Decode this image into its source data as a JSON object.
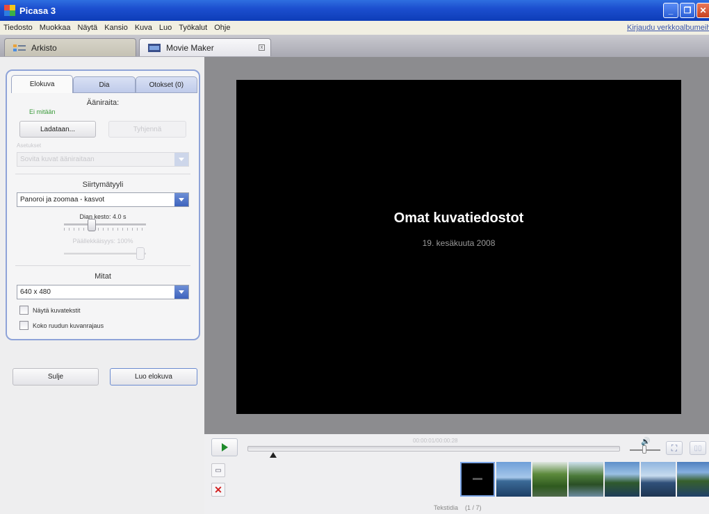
{
  "window": {
    "title": "Picasa 3"
  },
  "menu": {
    "items": [
      "Tiedosto",
      "Muokkaa",
      "Näytä",
      "Kansio",
      "Kuva",
      "Luo",
      "Työkalut",
      "Ohje"
    ],
    "login_link": "Kirjaudu verkkoalbumeihin"
  },
  "tabs": {
    "archive": "Arkisto",
    "moviemaker": "Movie Maker"
  },
  "panel": {
    "tabs": [
      "Elokuva",
      "Dia",
      "Otokset (0)"
    ],
    "audio_heading": "Ääniraita:",
    "audio_status": "Ei mitään",
    "load_button": "Ladataan...",
    "clear_button": "Tyhjennä",
    "options_label": "Asetukset",
    "options_value": "Sovita kuvat ääniraitaan",
    "transition_heading": "Siirtymätyyli",
    "transition_value": "Panoroi ja zoomaa - kasvot",
    "slide_duration_label": "Dian kesto: 4.0 s",
    "overlap_label": "Päällekkäisyys: 100%",
    "dimensions_heading": "Mitat",
    "dimensions_value": "640 x 480",
    "checkbox_captions": "Näytä kuvatekstit",
    "checkbox_fullframe": "Koko ruudun kuvanrajaus",
    "close_button": "Sulje",
    "create_button": "Luo elokuva"
  },
  "preview": {
    "title": "Omat kuvatiedostot",
    "date": "19. kesäkuuta 2008"
  },
  "playback": {
    "timecode": "00:00:01/00:00:28",
    "status": "Tekstidia    (1 / 7)"
  },
  "colors": {
    "title_bar": "#1c4fcf",
    "play_green": "#1f8b2a",
    "delete_red": "#d22020",
    "audio_status_green": "#3a9a3a"
  }
}
